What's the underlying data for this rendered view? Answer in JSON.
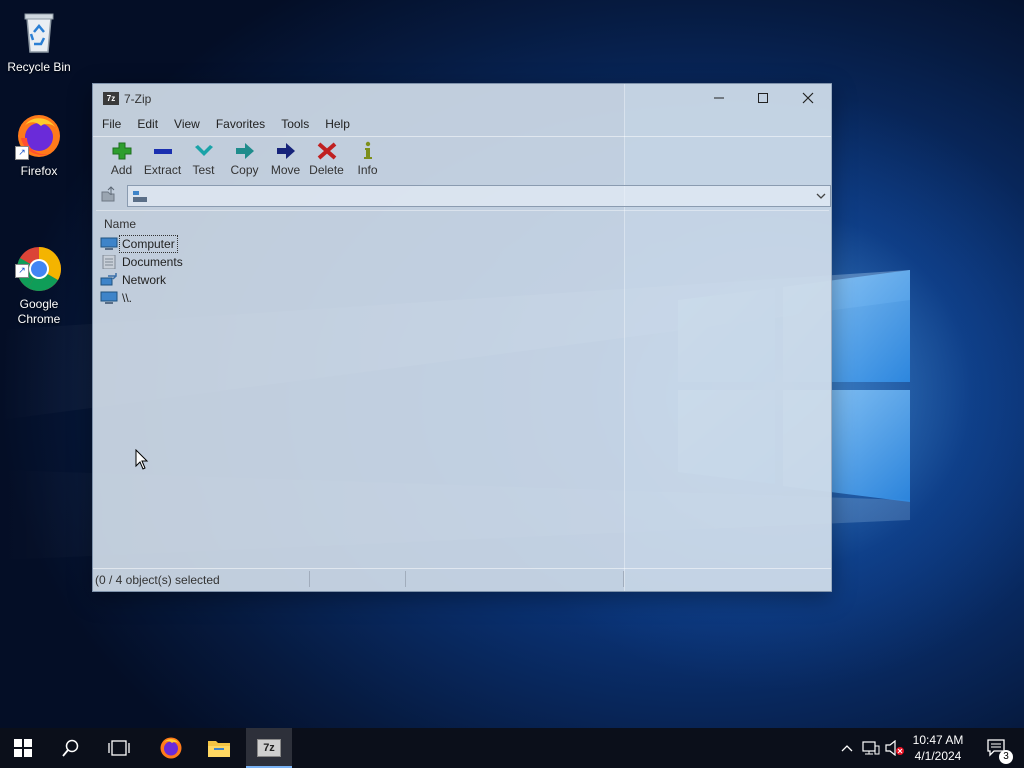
{
  "desktop": {
    "icons": [
      {
        "label": "Recycle Bin"
      },
      {
        "label": "Firefox"
      },
      {
        "label": "Google\nChrome"
      }
    ]
  },
  "window": {
    "title": "7-Zip",
    "app_icon_text": "7z",
    "menu": [
      "File",
      "Edit",
      "View",
      "Favorites",
      "Tools",
      "Help"
    ],
    "toolbar": [
      "Add",
      "Extract",
      "Test",
      "Copy",
      "Move",
      "Delete",
      "Info"
    ],
    "address_value": "",
    "column_header": "Name",
    "items": [
      "Computer",
      "Documents",
      "Network",
      "\\\\."
    ],
    "status": "(0 / 4 object(s) selected"
  },
  "taskbar": {
    "time": "10:47 AM",
    "date": "4/1/2024",
    "notification_count": "3",
    "active_app_icon_text": "7z"
  },
  "colors": {
    "add": "#2e9e2e",
    "extract": "#1a2fb0",
    "test": "#1aa3a8",
    "copy": "#1f8c8c",
    "move": "#16237a",
    "delete": "#c02020",
    "info": "#7d8f1c",
    "taskbar": "#0b0f1a",
    "accent": "#7ab3f5"
  }
}
